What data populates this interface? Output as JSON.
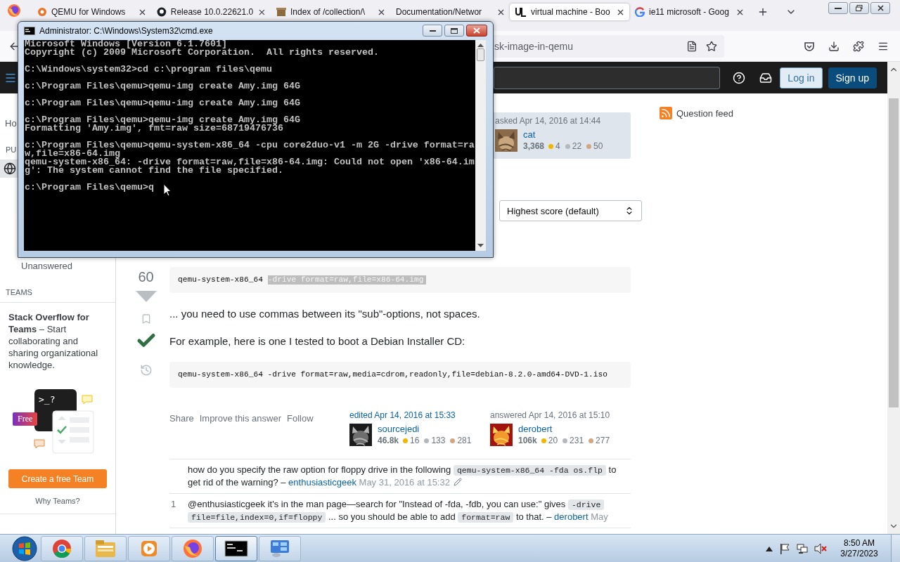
{
  "browser": {
    "tabs": [
      {
        "title": "QEMU for Windows",
        "kind": "qemu",
        "selected": false
      },
      {
        "title": "Release 10.0.22621.0",
        "kind": "github",
        "selected": false
      },
      {
        "title": "Index of /collection/\\",
        "kind": "archive",
        "selected": false
      },
      {
        "title": "Documentation/Networ",
        "kind": "plain",
        "selected": false
      },
      {
        "title": "virtual machine - Boo",
        "kind": "unix",
        "selected": true
      },
      {
        "title": "ie11 microsoft - Goog",
        "kind": "google",
        "selected": false
      }
    ],
    "address": "sk-image-in-qemu"
  },
  "site_header": {
    "log_in": "Log in",
    "sign_up": "Sign up"
  },
  "left_nav": {
    "top": [
      {
        "kind": "link",
        "label": "Ho"
      },
      {
        "kind": "heading",
        "label": "PU"
      },
      {
        "kind": "globe",
        "selected": true
      }
    ],
    "bottom": [
      {
        "kind": "link",
        "label": "Unanswered"
      },
      {
        "kind": "heading",
        "label": "TEAMS"
      }
    ]
  },
  "teams_promo": {
    "text": "**Stack Overflow for Teams** – Start collaborating and sharing organizational knowledge.",
    "prompt": ">_?",
    "badge": "Free",
    "button": "Create a free Team",
    "link": "Why Teams?"
  },
  "question": {
    "asked": "asked Apr 14, 2016 at 14:44",
    "user": {
      "name": "cat",
      "reputation": "3,368",
      "badges": [
        {
          "count": "4",
          "color": "#f1b600"
        },
        {
          "count": "22",
          "color": "#b4b8bc"
        },
        {
          "count": "50",
          "color": "#d1a684"
        }
      ]
    }
  },
  "sort": {
    "value": "Highest score (default)"
  },
  "right_sidebar": {
    "feed": "Question feed"
  },
  "answer": {
    "score": "60",
    "accepted": true,
    "blocks": [
      {
        "kind": "code",
        "segments": [
          {
            "text": "qemu-system-x86_64",
            "highlighted": false
          },
          {
            "text": "-drive format=raw,file=x86-64.img",
            "highlighted": true
          }
        ]
      },
      {
        "kind": "text",
        "text": "... you need to use commas between its \"sub\"-options, not spaces."
      },
      {
        "kind": "text",
        "text": "For example, here is one I tested to boot a Debian Installer CD:"
      },
      {
        "kind": "code",
        "segments": [
          {
            "text": "qemu-system-x86_64 -drive format=raw,media=cdrom,readonly,file=debian-8.2.0-amd64-DVD-1.iso",
            "highlighted": false
          }
        ]
      }
    ],
    "menu": [
      "Share",
      "Improve this answer",
      "Follow"
    ],
    "signatures": [
      {
        "kind": "edited",
        "action": "edited Apr 14, 2016 at 15:33",
        "name": "sourcejedi",
        "reputation": "46.8k",
        "badges": [
          {
            "count": "16",
            "color": "#f1b600"
          },
          {
            "count": "133",
            "color": "#b4b8bc"
          },
          {
            "count": "281",
            "color": "#d1a684"
          }
        ]
      },
      {
        "kind": "answered",
        "action": "answered Apr 14, 2016 at 15:10",
        "name": "derobert",
        "reputation": "106k",
        "badges": [
          {
            "count": "20",
            "color": "#f1b600"
          },
          {
            "count": "231",
            "color": "#b4b8bc"
          },
          {
            "count": "277",
            "color": "#d1a684"
          }
        ]
      }
    ],
    "comments": [
      {
        "segments": [
          {
            "kind": "text",
            "text": "how do you specify the raw option for floppy drive in the following "
          },
          {
            "kind": "code",
            "text": "qemu-system-x86_64 -fda os.flp"
          },
          {
            "kind": "text",
            "text": " to get rid of the warning? – "
          },
          {
            "kind": "user",
            "text": "enthusiasticgeek"
          },
          {
            "kind": "date",
            "text": "May 31, 2016 at 15:32"
          }
        ],
        "edited": true
      },
      {
        "score": "1",
        "segments": [
          {
            "kind": "text",
            "text": "@enthusiasticgeek it's in the man page—search for \"Instead of -fda, -fdb, you can use:\" gives "
          },
          {
            "kind": "code",
            "text": "-drive file=file,index=0,if=floppy"
          },
          {
            "kind": "text",
            "text": " ... so you should be able to add "
          },
          {
            "kind": "code",
            "text": "format=raw"
          },
          {
            "kind": "text",
            "text": " to that. – "
          },
          {
            "kind": "user",
            "text": "derobert"
          },
          {
            "kind": "date",
            "text": "May"
          }
        ],
        "edited": false
      }
    ]
  },
  "cmd": {
    "title": "Administrator: C:\\Windows\\System32\\cmd.exe",
    "blocks": [
      [
        "Microsoft Windows [Version 6.1.7601]",
        "Copyright (c) 2009 Microsoft Corporation.  All rights reserved."
      ],
      [
        "C:\\Windows\\system32>cd c:\\program files\\qemu"
      ],
      [
        "c:\\Program Files\\qemu>qemu-img create Amy.img 64G"
      ],
      [
        "c:\\Program Files\\qemu>qemu-img create Amy.img 64G"
      ],
      [
        "c:\\Program Files\\qemu>qemu-img create Amy.img 64G",
        "Formatting 'Amy.img', fmt=raw size=68719476736"
      ],
      [
        "c:\\Program Files\\qemu>qemu-system-x86_64 -cpu core2duo-v1 -m 2G -drive format=ra",
        "w,file=x86-64.img",
        "qemu-system-x86_64: -drive format=raw,file=x86-64.img: Could not open 'x86-64.im",
        "g': The system cannot find the file specified."
      ],
      [
        "c:\\Program Files\\qemu>q"
      ]
    ]
  },
  "taskbar": {
    "apps": [
      {
        "kind": "start"
      },
      {
        "kind": "chrome",
        "selected": false
      },
      {
        "kind": "explorer",
        "selected": false
      },
      {
        "kind": "media",
        "selected": false
      },
      {
        "kind": "firefox",
        "selected": false
      },
      {
        "kind": "cmd",
        "selected": true
      },
      {
        "kind": "control",
        "selected": false
      }
    ],
    "tray": [
      {
        "kind": "arrow"
      },
      {
        "kind": "flag"
      },
      {
        "kind": "network"
      },
      {
        "kind": "volume",
        "muted": true
      }
    ],
    "time": "8:50 AM",
    "date": "3/27/2023"
  }
}
